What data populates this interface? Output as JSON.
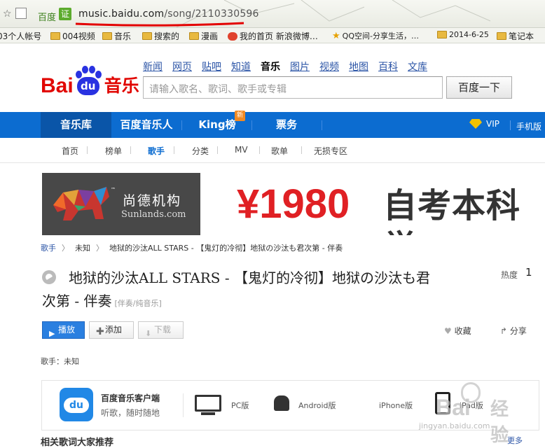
{
  "browser": {
    "brand": "百度",
    "cert_badge": "证",
    "url_host": "music.baidu.com",
    "url_path": "/song/2110330596",
    "bookmarks": [
      {
        "label": "03个人帐号",
        "icon": "none"
      },
      {
        "label": "004视频",
        "icon": "folder-icon"
      },
      {
        "label": "音乐",
        "icon": "folder-icon"
      },
      {
        "label": "搜索的",
        "icon": "folder-icon"
      },
      {
        "label": "漫画",
        "icon": "folder-icon"
      },
      {
        "label": "我的首页 新浪微博…",
        "icon": "weibo-icon"
      },
      {
        "label": "QQ空间-分享生活，…",
        "icon": "star-icon"
      },
      {
        "label": "2014-6-25",
        "icon": "folder-icon"
      },
      {
        "label": "笔记本",
        "icon": "folder-icon"
      }
    ]
  },
  "header": {
    "logo_bai": "Bai",
    "logo_du": "du",
    "logo_music": "音乐",
    "top_links": [
      "新闻",
      "网页",
      "贴吧",
      "知道",
      "音乐",
      "图片",
      "视频",
      "地图",
      "百科",
      "文库"
    ],
    "top_links_current": "音乐",
    "search_placeholder": "请输入歌名、歌词、歌手或专辑",
    "search_button": "百度一下"
  },
  "nav": {
    "items": [
      "音乐库",
      "百度音乐人",
      "King榜",
      "票务"
    ],
    "new_badge": "新",
    "vip": "VIP",
    "mobile": "手机版"
  },
  "subnav": {
    "items": [
      "首页",
      "榜单",
      "歌手",
      "分类",
      "MV",
      "歌单",
      "无损专区"
    ],
    "current": "歌手"
  },
  "banner": {
    "tm": "™",
    "brand_cn": "尚德机构",
    "brand_en": "Sunlands.com",
    "price": "¥1980",
    "headline": "自考本科学"
  },
  "breadcrumb": [
    "歌手",
    "未知",
    "地狱的沙汰ALL STARS - 【鬼灯的冷彻】地狱の沙汰も君次第 - 伴奏"
  ],
  "song": {
    "title": "地狱的沙汰ALL STARS - 【鬼灯的冷彻】地狱の沙汰も君次第 - 伴奏",
    "tag": "[伴奏/纯音乐]",
    "hot_label": "热度",
    "hot_value": "1",
    "buttons": {
      "play": "播放",
      "add": "添加",
      "download": "下载",
      "collect": "收藏",
      "share": "分享"
    },
    "singer": "歌手：未知"
  },
  "client": {
    "name": "百度音乐客户端",
    "slogan": "听歌，随时随地",
    "platforms": [
      "PC版",
      "Android版",
      "iPhone版",
      "iPad版"
    ]
  },
  "watermark": {
    "brand": "Bai",
    "word": "经验",
    "url": "jingyan.baidu.com"
  },
  "bottom": {
    "heading": "相关歌词大家推荐",
    "more": "更多"
  }
}
